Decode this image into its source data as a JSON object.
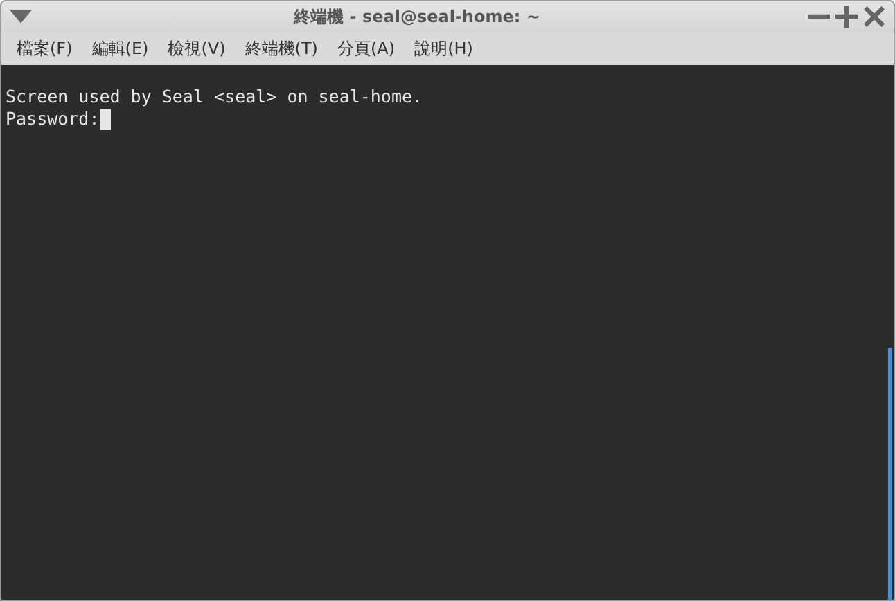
{
  "window": {
    "title": "終端機 - seal@seal-home: ~"
  },
  "menu": [
    "檔案(F)",
    "編輯(E)",
    "檢視(V)",
    "終端機(T)",
    "分頁(A)",
    "說明(H)"
  ],
  "terminal": {
    "lines": [
      "Screen used by Seal <seal> on seal-home.",
      "Password:"
    ]
  }
}
